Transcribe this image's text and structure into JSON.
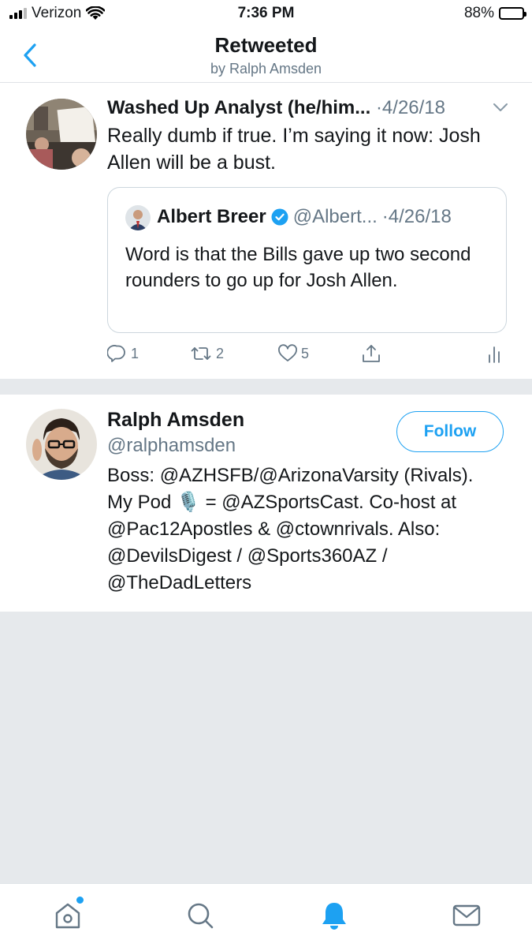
{
  "status_bar": {
    "carrier": "Verizon",
    "time": "7:36 PM",
    "battery": "88%",
    "battery_level": 0.88
  },
  "header": {
    "title": "Retweeted",
    "subtitle": "by Ralph Amsden"
  },
  "tweet": {
    "author_name": "Washed Up Analyst (he/him...",
    "date": "·4/26/18",
    "text": "Really dumb if true. I’m saying it now: Josh Allen will be a bust.",
    "quote": {
      "author_name": "Albert Breer",
      "handle": "@Albert...",
      "date": "·4/26/18",
      "text": "Word is that the Bills gave up two second rounders to go up for Josh Allen."
    },
    "actions": {
      "replies": "1",
      "retweets": "2",
      "likes": "5"
    }
  },
  "profile": {
    "name": "Ralph Amsden",
    "handle": "@ralphamsden",
    "follow_label": "Follow",
    "bio": "Boss: @AZHSFB/@ArizonaVarsity (Rivals).\nMy Pod 🎙️ = @AZSportsCast. Co-host at\n@Pac12Apostles & @ctownrivals. Also:\n@DevilsDigest / @Sports360AZ /\n@TheDadLetters"
  },
  "tab_bar": {
    "items": [
      "home-icon",
      "search-icon",
      "notifications-icon",
      "messages-icon"
    ]
  },
  "colors": {
    "accent": "#1da1f2",
    "secondary_text": "#657786",
    "background": "#e6e9ec"
  }
}
